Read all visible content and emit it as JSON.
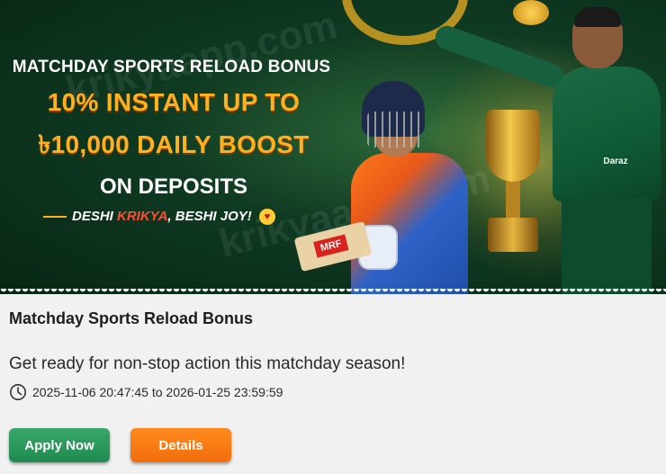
{
  "banner": {
    "headline": "MATCHDAY SPORTS RELOAD BONUS",
    "offer_line_1": "10% INSTANT UP TO",
    "offer_line_2": "৳10,000 DAILY BOOST",
    "offer_line_3": "ON DEPOSITS",
    "slogan_prefix": "DESHI",
    "slogan_brand": "KRIKYA",
    "slogan_suffix": ", BESHI JOY!",
    "watermark": "krikyaapp.com",
    "bat_logo": "MRF",
    "jersey_sponsor": "Daraz",
    "icons": [
      "clock-icon",
      "heart-eyes-emoji"
    ],
    "colors": {
      "offer": "#ffb01e",
      "brand": "#ff4d2e",
      "background": "#0f3a22"
    }
  },
  "promo": {
    "title": "Matchday Sports Reload Bonus",
    "description": "Get ready for non-stop action this matchday season!",
    "period": "2025-11-06 20:47:45 to 2026-01-25 23:59:59"
  },
  "actions": {
    "apply_label": "Apply Now",
    "details_label": "Details",
    "apply_color": "#2e9a5c",
    "details_color": "#f57a12"
  }
}
